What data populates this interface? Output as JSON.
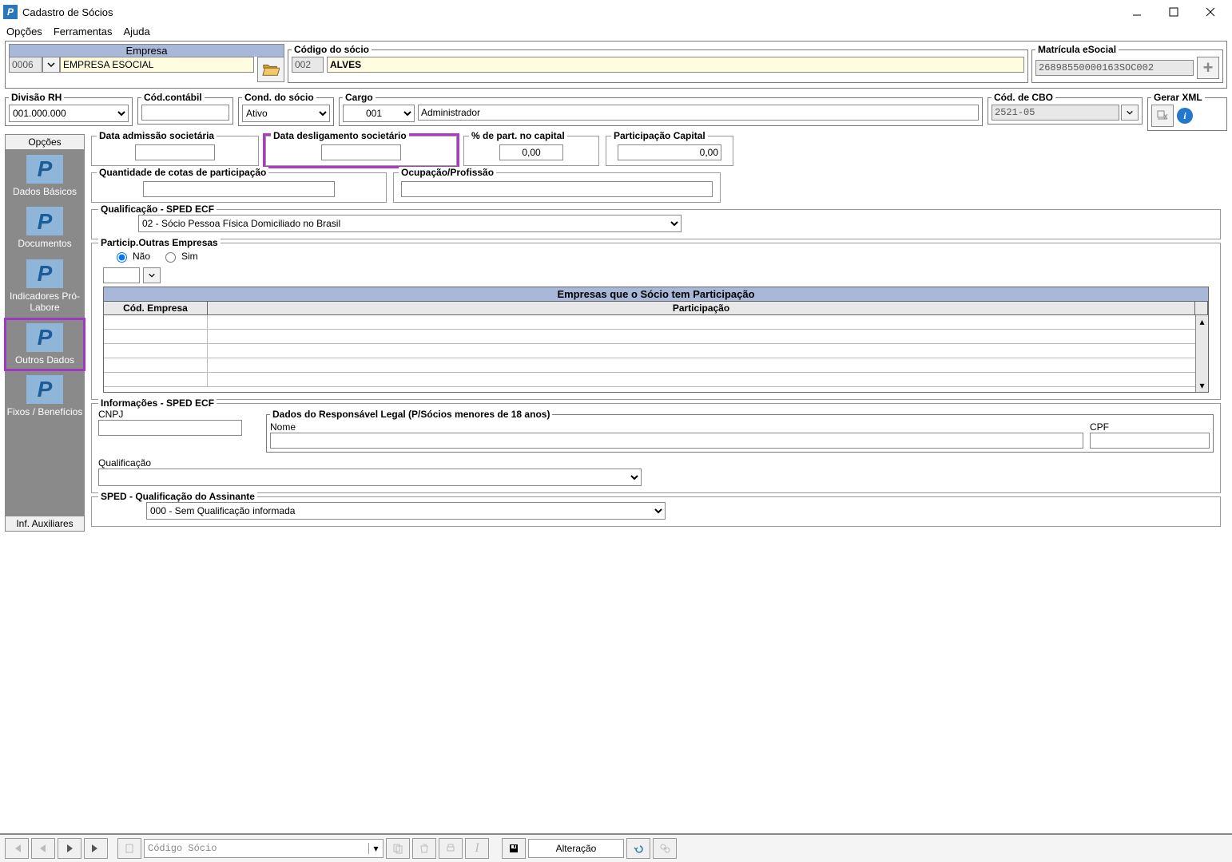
{
  "window": {
    "title": "Cadastro de Sócios"
  },
  "menu": {
    "opcoes": "Opções",
    "ferramentas": "Ferramentas",
    "ajuda": "Ajuda"
  },
  "empresa": {
    "header": "Empresa",
    "codigo": "0006",
    "nome": "EMPRESA ESOCIAL"
  },
  "codigo_socio": {
    "legend": "Código do sócio",
    "code": "002",
    "name": "ALVES"
  },
  "matricula": {
    "legend": "Matrícula eSocial",
    "value": "26898550000163SOC002"
  },
  "row2": {
    "divisao_rh": {
      "label": "Divisão RH",
      "value": "001.000.000"
    },
    "cod_contabil": {
      "label": "Cód.contábil",
      "value": ""
    },
    "cond_socio": {
      "label": "Cond. do sócio",
      "value": "Ativo"
    },
    "cargo": {
      "label": "Cargo",
      "code": "001",
      "desc": "Administrador"
    },
    "cod_cbo": {
      "label": "Cód. de CBO",
      "value": "2521-05"
    },
    "gerar_xml": {
      "label": "Gerar XML"
    }
  },
  "sidebar": {
    "top_tab": "Opções",
    "items": [
      {
        "label": "Dados Básicos"
      },
      {
        "label": "Documentos"
      },
      {
        "label": "Indicadores Pró-Labore"
      },
      {
        "label": "Outros Dados"
      },
      {
        "label": "Fixos / Benefícios"
      }
    ],
    "bottom_tab": "Inf. Auxiliares"
  },
  "main": {
    "data_admissao": {
      "label": "Data admissão societária",
      "value": ""
    },
    "data_desligamento": {
      "label": "Data desligamento societário",
      "value": ""
    },
    "pct_part": {
      "label": "% de part. no capital",
      "value": "0,00"
    },
    "part_capital": {
      "label": "Participação Capital",
      "value": "0,00"
    },
    "qtd_cotas": {
      "label": "Quantidade de cotas de participação",
      "value": ""
    },
    "ocupacao": {
      "label": "Ocupação/Profissão",
      "value": ""
    },
    "qualif_sped": {
      "label": "Qualificação - SPED ECF",
      "value": "02 - Sócio Pessoa Física Domiciliado no Brasil"
    },
    "particip_outras": {
      "label": "Particip.Outras Empresas",
      "nao": "Não",
      "sim": "Sim",
      "table_title": "Empresas que o Sócio tem Participação",
      "col1": "Cód. Empresa",
      "col2": "Participação"
    },
    "info_sped": {
      "label": "Informações - SPED ECF",
      "cnpj_label": "CNPJ",
      "cnpj": "",
      "resp_legend": "Dados do Responsável Legal (P/Sócios menores de 18 anos)",
      "nome_label": "Nome",
      "nome": "",
      "cpf_label": "CPF",
      "cpf": "",
      "qualif_label": "Qualificação",
      "qualif": ""
    },
    "sped_assinante": {
      "label": "SPED - Qualificação do Assinante",
      "value": "000 - Sem Qualificação informada"
    }
  },
  "bottombar": {
    "search_placeholder": "Código Sócio",
    "mode": "Alteração"
  }
}
